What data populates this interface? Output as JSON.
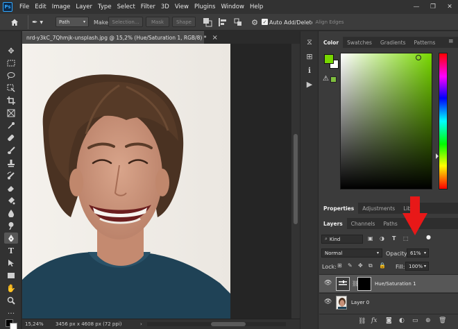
{
  "menu": {
    "logo": "Ps",
    "items": [
      "File",
      "Edit",
      "Image",
      "Layer",
      "Type",
      "Select",
      "Filter",
      "3D",
      "View",
      "Plugins",
      "Window",
      "Help"
    ],
    "window_controls": [
      "—",
      "❐",
      "✕"
    ]
  },
  "options": {
    "mode_value": "Path",
    "make_label": "Make:",
    "selection_btn": "Selection...",
    "mask_btn": "Mask",
    "shape_btn": "Shape",
    "auto_add_delete_label": "Auto Add/Delete",
    "auto_add_delete_checked": true,
    "align_edges_btn": "Align Edges"
  },
  "document": {
    "tab_title": "nrd-y3kC_7Qhmjk-unsplash.jpg @ 15,2% (Hue/Saturation 1, RGB/8) *",
    "close_glyph": "×"
  },
  "status": {
    "zoom": "15,24%",
    "dimensions": "3456 px x 4608 px (72 ppi)"
  },
  "color_panel": {
    "tabs": [
      "Color",
      "Swatches",
      "Gradients",
      "Patterns"
    ],
    "active_tab": 0,
    "foreground": "#78d800",
    "background": "#ffffff",
    "warning_swatch": "#7fbf3f"
  },
  "properties_panel": {
    "tabs": [
      "Properties",
      "Adjustments",
      "Libra"
    ],
    "active_tab": 0
  },
  "layers_panel": {
    "tabs": [
      "Layers",
      "Channels",
      "Paths"
    ],
    "active_tab": 0,
    "filter_kind": "Kind",
    "blend_mode": "Normal",
    "opacity_label": "Opacity:",
    "opacity_value": "61%",
    "lock_label": "Lock:",
    "fill_label": "Fill:",
    "fill_value": "100%",
    "layers": [
      {
        "name": "Hue/Saturation 1",
        "selected": true
      },
      {
        "name": "Layer 0",
        "selected": false
      }
    ],
    "bottom_icons": [
      "link-icon",
      "fx-icon",
      "mask-icon",
      "adjustment-icon",
      "group-icon",
      "new-layer-icon",
      "trash-icon"
    ],
    "fx_label": "fx"
  },
  "annotation": {
    "arrow_color": "#e81818"
  }
}
